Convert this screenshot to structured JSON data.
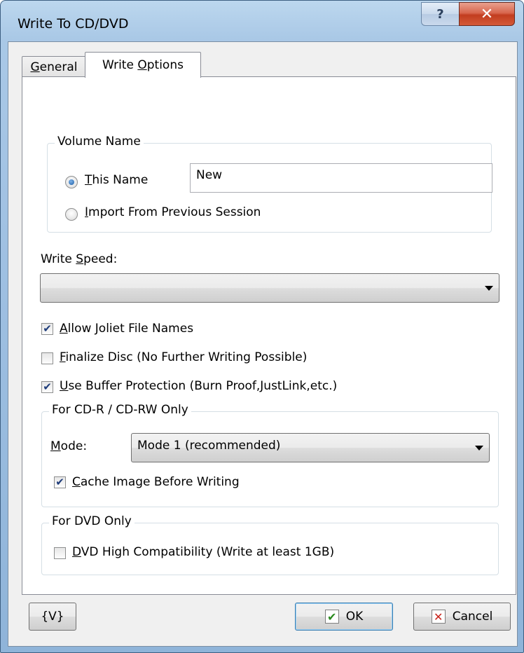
{
  "window": {
    "title": "Write To CD/DVD",
    "help_glyph": "?",
    "close_glyph": "✕"
  },
  "tabs": [
    {
      "label_pre": "",
      "label_key": "G",
      "label_post": "eneral",
      "active": false
    },
    {
      "label_pre": "Write ",
      "label_key": "O",
      "label_post": "ptions",
      "active": true
    }
  ],
  "volume_group": {
    "legend": "Volume Name",
    "this_name": {
      "key": "T",
      "rest": "his Name",
      "checked": true
    },
    "name_value": "New",
    "import_option": {
      "key": "I",
      "rest": "mport From Previous Session",
      "checked": false
    }
  },
  "write_speed": {
    "label_pre": "Write ",
    "label_key": "S",
    "label_post": "peed:",
    "selected": ""
  },
  "options": [
    {
      "key": "A",
      "rest": "llow Joliet File Names",
      "checked": true
    },
    {
      "key": "F",
      "rest": "inalize Disc (No Further Writing Possible)",
      "checked": false
    },
    {
      "key": "U",
      "rest": "se Buffer Protection (Burn Proof,JustLink,etc.)",
      "checked": true
    }
  ],
  "cd_group": {
    "legend": "For CD-R / CD-RW Only",
    "mode_label_key": "M",
    "mode_label_rest": "ode:",
    "mode_selected": "Mode 1 (recommended)",
    "cache": {
      "key": "C",
      "rest": "ache Image Before Writing",
      "checked": true
    }
  },
  "dvd_group": {
    "legend": "For DVD Only",
    "high_compat": {
      "key": "D",
      "rest": "VD High Compatibility (Write at least 1GB)",
      "checked": false
    }
  },
  "footer": {
    "variables_label": "{V}",
    "ok_label": "OK",
    "ok_icon": "✔",
    "cancel_label": "Cancel",
    "cancel_icon": "✕"
  },
  "colors": {
    "ok_icon": "#2a8a1e",
    "cancel_icon": "#c8231b"
  }
}
